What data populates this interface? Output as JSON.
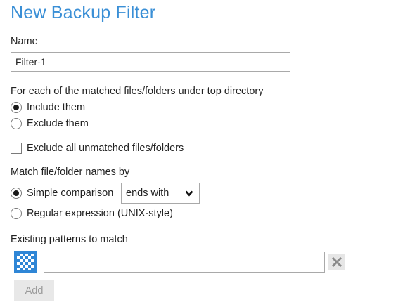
{
  "dialog": {
    "title": "New Backup Filter"
  },
  "name_field": {
    "label": "Name",
    "value": "Filter-1"
  },
  "matched_action": {
    "label": "For each of the matched files/folders under top directory",
    "options": [
      {
        "label": "Include them",
        "checked": true
      },
      {
        "label": "Exclude them",
        "checked": false
      }
    ]
  },
  "exclude_unmatched": {
    "label": "Exclude all unmatched files/folders",
    "checked": false
  },
  "match_by": {
    "label": "Match file/folder names by",
    "options": [
      {
        "label": "Simple comparison",
        "checked": true
      },
      {
        "label": "Regular expression (UNIX-style)",
        "checked": false
      }
    ],
    "comparison_select": {
      "value": "ends with",
      "icon": "chevron-down-icon"
    }
  },
  "patterns": {
    "label": "Existing patterns to match",
    "input_value": "",
    "pattern_icon": "pattern-grid-icon",
    "pattern_icon_color": "#2f86d6",
    "clear_icon": "close-icon",
    "add_label": "Add"
  },
  "colors": {
    "title": "#3a8fd6"
  }
}
